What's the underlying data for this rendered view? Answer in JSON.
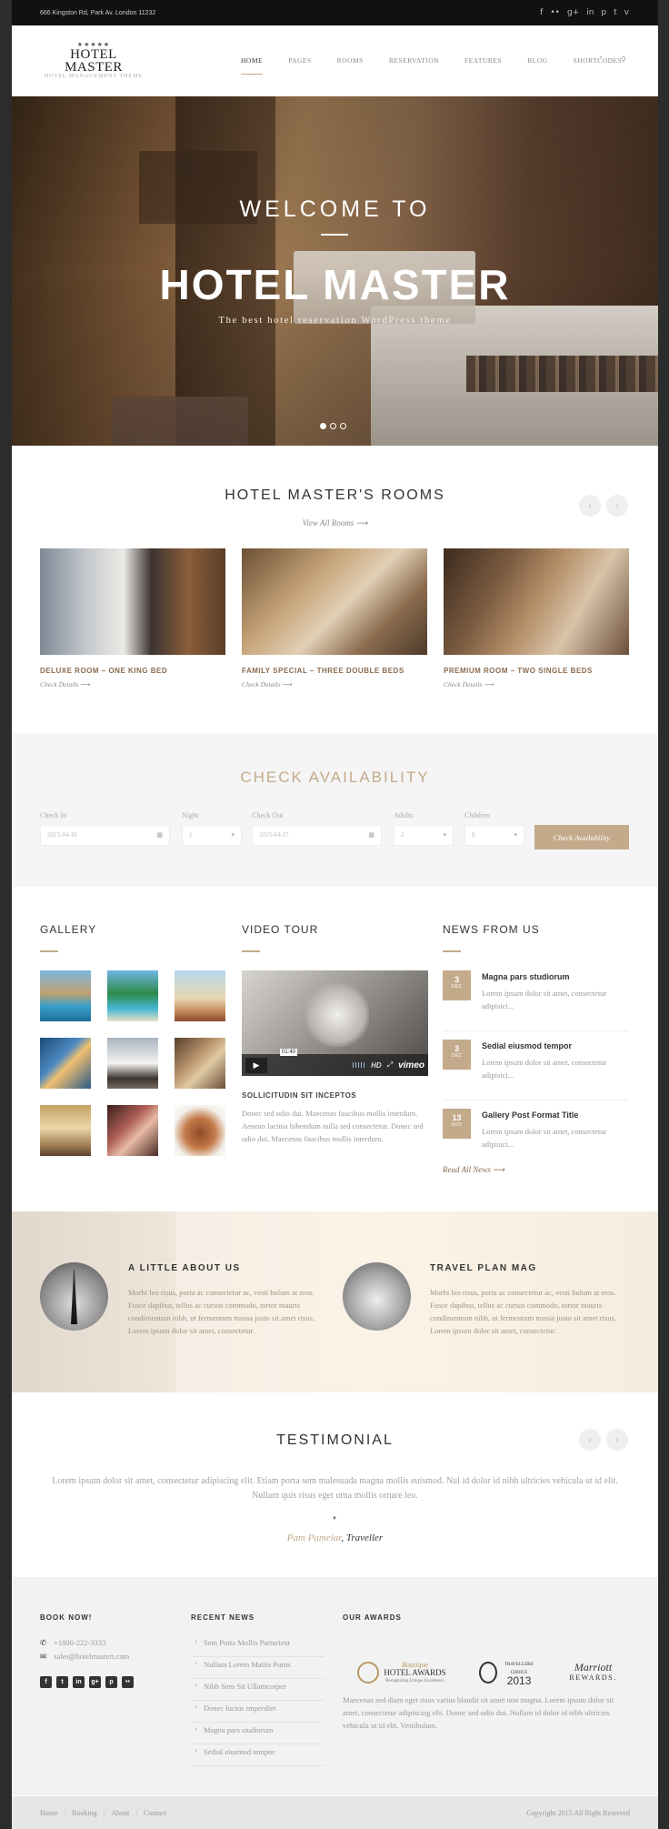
{
  "topbar": {
    "address": "666 Kingston Rd, Park Av. London 11232",
    "social_icons": [
      "facebook-icon",
      "flickr-icon",
      "google-plus-icon",
      "linkedin-icon",
      "pinterest-icon",
      "twitter-icon",
      "vimeo-icon"
    ]
  },
  "header": {
    "logo_stars": "★★★★★",
    "logo_title": "HOTEL MASTER",
    "logo_subtitle": "HOTEL MANAGEMENT THEME",
    "nav": [
      "HOME",
      "PAGES",
      "ROOMS",
      "RESERVATION",
      "FEATURES",
      "BLOG",
      "SHORTCODES"
    ],
    "active_nav": "HOME"
  },
  "hero": {
    "welcome": "WELCOME TO",
    "title": "HOTEL MASTER",
    "subtitle": "The best hotel reservation WordPress theme",
    "slides": 3,
    "active_slide": 1
  },
  "rooms": {
    "title": "HOTEL MASTER'S ROOMS",
    "view_all": "View All Rooms  ⟶",
    "items": [
      {
        "name": "DELUXE ROOM – ONE KING BED",
        "link": "Check Details  ⟶"
      },
      {
        "name": "FAMILY SPECIAL – THREE DOUBLE BEDS",
        "link": "Check Details  ⟶"
      },
      {
        "name": "PREMIUM ROOM – TWO SINGLE BEDS",
        "link": "Check Details  ⟶"
      }
    ]
  },
  "availability": {
    "title": "CHECK AVAILABILITY",
    "labels": {
      "check_in": "Check In",
      "night": "Night",
      "check_out": "Check Out",
      "adults": "Adults",
      "children": "Children"
    },
    "values": {
      "check_in": "2015-04-16",
      "night": "1",
      "check_out": "2015-04-17",
      "adults": "2",
      "children": "0"
    },
    "button": "Check Availability"
  },
  "gallery": {
    "title": "GALLERY"
  },
  "video": {
    "title": "VIDEO TOUR",
    "time": "01:40",
    "brand": "vimeo",
    "hd": "HD",
    "post_title": "SOLLICITUDIN SIT INCEPTOS",
    "text": "Donec sed odio dui. Maecenas faucibus mollis interdum. Aenean lacinia bibendum nulla sed consectetur. Donec sed odio dui. Maecenas faucibus mollis interdum."
  },
  "news": {
    "title": "NEWS FROM US",
    "items": [
      {
        "day": "3",
        "month": "DEC",
        "title": "Magna pars studiorum",
        "excerpt": "Lorem ipsum dolor sit amet, consectetur adipisici..."
      },
      {
        "day": "3",
        "month": "DEC",
        "title": "Sedial eiusmod tempor",
        "excerpt": "Lorem ipsum dolor sit amet, consectetur adipisici..."
      },
      {
        "day": "13",
        "month": "NOV",
        "title": "Gallery Post Format Title",
        "excerpt": "Lorem ipsum dolor sit amet, consectetur adipisici..."
      }
    ],
    "read_all": "Read All News  ⟶"
  },
  "about": {
    "left_title": "A LITTLE ABOUT US",
    "left_text": "Morbi leo risus, porta ac consectetur ac, vesti bulum at eros. Fusce dapibus, tellus ac cursus commodo, tortor mauris condimentum nibh, ut fermentum massa justo sit amet risus. Lorem ipsum dolor sit amet, consectetur.",
    "right_title": "TRAVEL PLAN MAG",
    "right_text": "Morbi leo risus, porta ac consectetur ac, vesti bulum at eros. Fusce dapibus, tellus ac cursus commodo, tortor mauris condimentum nibh, ut fermentum massa justo sit amet risus. Lorem ipsum dolor sit amet, consectetur."
  },
  "testimonial": {
    "title": "TESTIMONIAL",
    "quote": "Lorem ipsum dolor sit amet, consectetur adipiscing elit. Etiam porta sem malesuada magna mollis euismod. Nul id dolor id nibh ultricies vehicula ut id elit. Nullam quis risus eget urna mollis ornare leo.",
    "author": "Pam Pamelar",
    "role": "Traveller"
  },
  "footer": {
    "book_title": "BOOK NOW!",
    "phone": "+1800-222-3333",
    "email": "sales@hotelmastert.com",
    "social": [
      "facebook-icon",
      "twitter-icon",
      "linkedin-icon",
      "google-plus-icon",
      "pinterest-icon",
      "flickr-icon"
    ],
    "recent_title": "RECENT NEWS",
    "recent": [
      "Sem Porta Mollis Parturient",
      "Nullam Lorem Mattis Purus",
      "Nibh Sem Sit Ullamcorper",
      "Donec luctus imperdiet",
      "Magna pars studiorum",
      "Sedial eiusmod tempor"
    ],
    "awards_title": "OUR AWARDS",
    "awards": {
      "a1_script": "Boutique",
      "a1_main": "HOTEL AWARDS",
      "a1_sub": "Recognizing Unique Excellence",
      "a2_label": "TRAVELLERS' CHOICE",
      "a2_year": "2013",
      "a3_brand": "Marriott",
      "a3_sub": "REWARDS."
    },
    "awards_text": "Maecenas sed diam eget risus varius blandit sit amet non magna. Lorem ipsum dolor sit amet, consectetur adipiscing elit. Donec sed odio dui. Nullam id dolor id nibh ultricies vehicula ut id elit. Vestibulum.",
    "bottom_links": [
      "Home",
      "Booking",
      "About",
      "Contact"
    ],
    "copyright": "Copyright 2015 All Right Reserved"
  },
  "colors": {
    "accent": "#c3aa8b",
    "dark": "#111111",
    "footer_bg": "#f2f2f2"
  }
}
